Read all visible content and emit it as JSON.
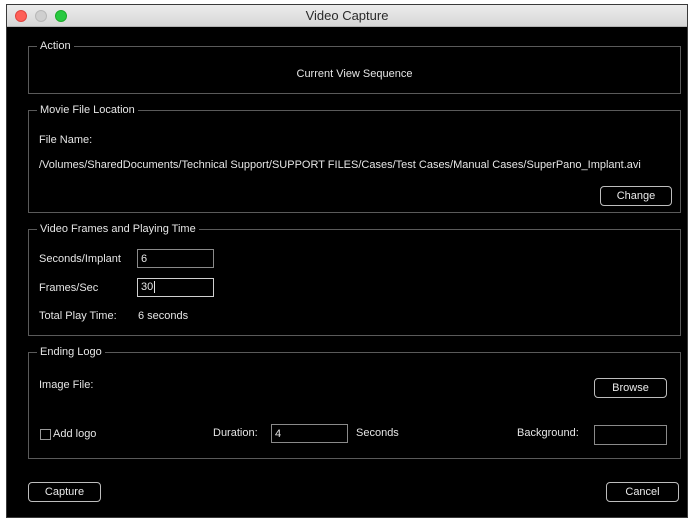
{
  "window": {
    "title": "Video Capture"
  },
  "action": {
    "legend": "Action",
    "value": "Current View Sequence"
  },
  "movie_file": {
    "legend": "Movie File Location",
    "file_name_label": "File Name:",
    "path": "/Volumes/SharedDocuments/Technical Support/SUPPORT FILES/Cases/Test Cases/Manual Cases/SuperPano_Implant.avi",
    "change_button": "Change"
  },
  "video_frames": {
    "legend": "Video Frames and Playing Time",
    "seconds_label": "Seconds/Implant",
    "seconds_value": "6",
    "frames_label": "Frames/Sec",
    "frames_value": "30",
    "total_label": "Total Play Time:",
    "total_value": "6 seconds"
  },
  "ending_logo": {
    "legend": "Ending Logo",
    "image_file_label": "Image File:",
    "browse_button": "Browse",
    "add_logo_label": "Add logo",
    "add_logo_checked": false,
    "duration_label": "Duration:",
    "duration_value": "4",
    "seconds_unit": "Seconds",
    "background_label": "Background:",
    "background_value": ""
  },
  "footer": {
    "capture_button": "Capture",
    "cancel_button": "Cancel"
  }
}
